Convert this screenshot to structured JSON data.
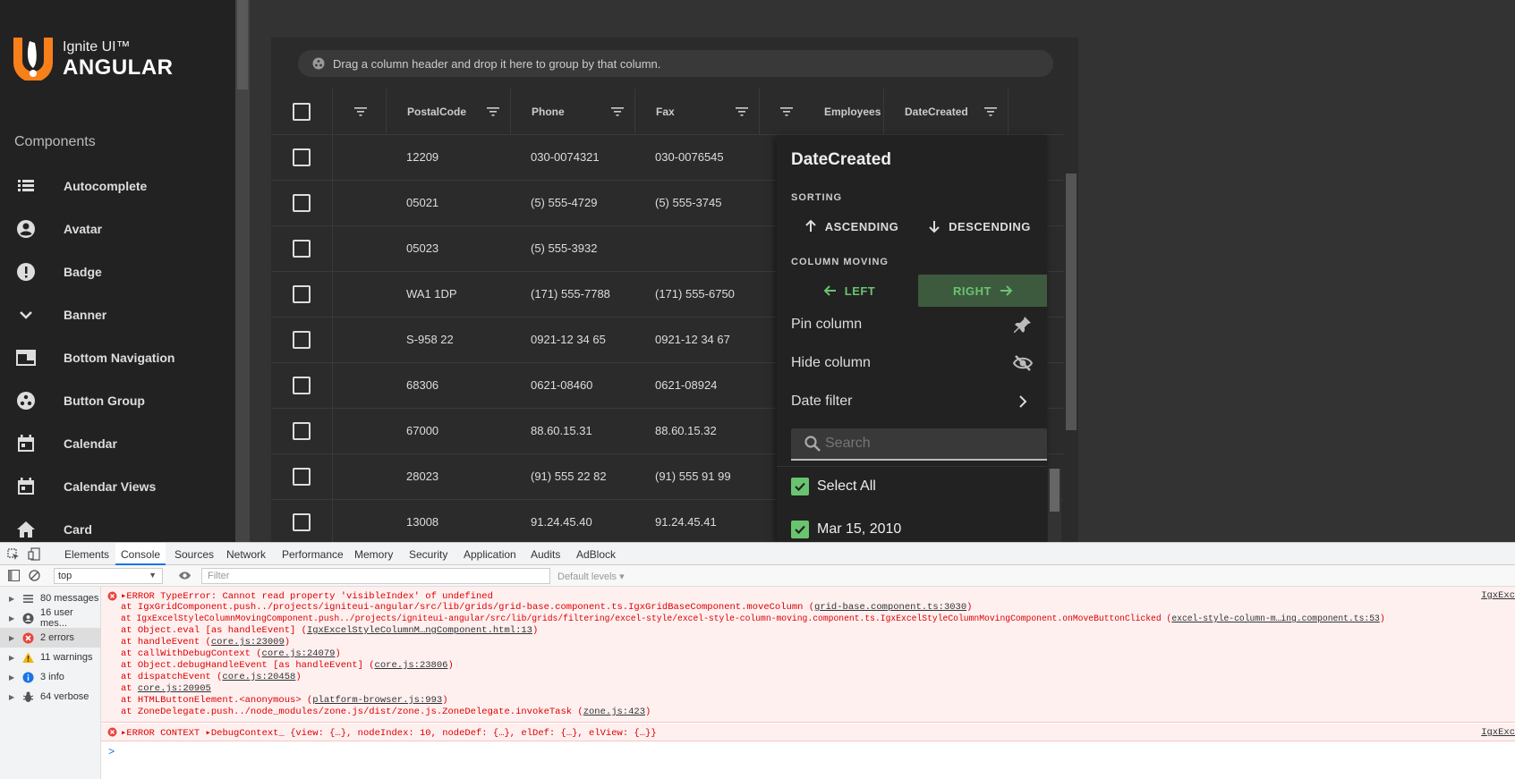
{
  "app": {
    "logo_line1": "Ignite UI™",
    "logo_line2": "ANGULAR",
    "sidebar_heading": "Components",
    "sidebar_items": [
      {
        "label": "Autocomplete",
        "icon": "list-icon"
      },
      {
        "label": "Avatar",
        "icon": "account-circle-icon"
      },
      {
        "label": "Badge",
        "icon": "error-icon"
      },
      {
        "label": "Banner",
        "icon": "chevron-down-icon"
      },
      {
        "label": "Bottom Navigation",
        "icon": "web-asset-icon"
      },
      {
        "label": "Button Group",
        "icon": "group-work-icon"
      },
      {
        "label": "Calendar",
        "icon": "calendar-icon"
      },
      {
        "label": "Calendar Views",
        "icon": "calendar-icon"
      },
      {
        "label": "Card",
        "icon": "home-icon"
      }
    ],
    "accent": "#f97f1b"
  },
  "grid": {
    "group_prompt": "Drag a column header and drop it here to group by that column.",
    "columns": [
      "",
      "PostalCode",
      "Phone",
      "Fax",
      "",
      "Employees",
      "DateCreated"
    ],
    "rows": [
      [
        "12209",
        "030-0074321",
        "030-0076545"
      ],
      [
        "05021",
        "(5) 555-4729",
        "(5) 555-3745"
      ],
      [
        "05023",
        "(5) 555-3932",
        ""
      ],
      [
        "WA1 1DP",
        "(171) 555-7788",
        "(171) 555-6750"
      ],
      [
        "S-958 22",
        "0921-12 34 65",
        "0921-12 34 67"
      ],
      [
        "68306",
        "0621-08460",
        "0621-08924"
      ],
      [
        "67000",
        "88.60.15.31",
        "88.60.15.32"
      ],
      [
        "28023",
        "(91) 555 22 82",
        "(91) 555 91 99"
      ],
      [
        "13008",
        "91.24.45.40",
        "91.24.45.41"
      ]
    ]
  },
  "esf": {
    "title": "DateCreated",
    "sorting_label": "SORTING",
    "ascending": "ASCENDING",
    "descending": "DESCENDING",
    "moving_label": "COLUMN MOVING",
    "left": "LEFT",
    "right": "RIGHT",
    "pin": "Pin column",
    "hide": "Hide column",
    "date_filter": "Date filter",
    "search_placeholder": "Search",
    "select_all": "Select All",
    "first_item": "Mar 15, 2010",
    "accent": "#6ac46f"
  },
  "devtools": {
    "tabs": [
      "Elements",
      "Console",
      "Sources",
      "Network",
      "Performance",
      "Memory",
      "Security",
      "Application",
      "Audits",
      "AdBlock"
    ],
    "active_tab": "Console",
    "context": "top",
    "filter_placeholder": "Filter",
    "levels": "Default levels ▾",
    "side_items": [
      {
        "label": "80 messages",
        "icon": "list-icon"
      },
      {
        "label": "16 user mes...",
        "icon": "user-icon"
      },
      {
        "label": "2 errors",
        "icon": "error-icon"
      },
      {
        "label": "11 warnings",
        "icon": "warning-icon"
      },
      {
        "label": "3 info",
        "icon": "info-icon"
      },
      {
        "label": "64 verbose",
        "icon": "bug-icon"
      }
    ],
    "error1": {
      "head": "▸ERROR TypeError: Cannot read property 'visibleIndex' of undefined",
      "source": "IgxExc",
      "lines": [
        {
          "text": "    at IgxGridComponent.push../projects/igniteui-angular/src/lib/grids/grid-base.component.ts.IgxGridBaseComponent.moveColumn (",
          "link": "grid-base.component.ts:3030",
          "tail": ")"
        },
        {
          "text": "    at IgxExcelStyleColumnMovingComponent.push../projects/igniteui-angular/src/lib/grids/filtering/excel-style/excel-style-column-moving.component.ts.IgxExcelStyleColumnMovingComponent.onMoveButtonClicked (",
          "link": "excel-style-column-m…ing.component.ts:53",
          "tail": ")"
        },
        {
          "text": "    at Object.eval [as handleEvent] (",
          "link": "IgxExcelStyleColumnM…ngComponent.html:13",
          "tail": ")"
        },
        {
          "text": "    at handleEvent (",
          "link": "core.js:23009",
          "tail": ")"
        },
        {
          "text": "    at callWithDebugContext (",
          "link": "core.js:24079",
          "tail": ")"
        },
        {
          "text": "    at Object.debugHandleEvent [as handleEvent] (",
          "link": "core.js:23806",
          "tail": ")"
        },
        {
          "text": "    at dispatchEvent (",
          "link": "core.js:20458",
          "tail": ")"
        },
        {
          "text": "    at ",
          "link": "core.js:20905",
          "tail": ""
        },
        {
          "text": "    at HTMLButtonElement.<anonymous> (",
          "link": "platform-browser.js:993",
          "tail": ")"
        },
        {
          "text": "    at ZoneDelegate.push../node_modules/zone.js/dist/zone.js.ZoneDelegate.invokeTask (",
          "link": "zone.js:423",
          "tail": ")"
        }
      ]
    },
    "error2": {
      "head": "▸ERROR CONTEXT ▸DebugContext_ {view: {…}, nodeIndex: 10, nodeDef: {…}, elDef: {…}, elView: {…}}",
      "source": "IgxExc"
    },
    "prompt": ">"
  }
}
